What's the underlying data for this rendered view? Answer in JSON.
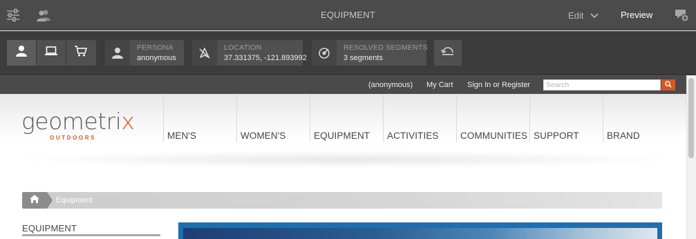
{
  "toolbar": {
    "side_panel_icon": "sliders-icon",
    "emulator_icon": "users-icon",
    "title": "EQUIPMENT",
    "mode_label": "Edit",
    "preview_label": "Preview",
    "annotation_icon": "add-annotation-icon"
  },
  "context_hub": {
    "profile_buttons": [
      {
        "icon": "person-icon"
      },
      {
        "icon": "laptop-icon"
      },
      {
        "icon": "cart-icon"
      }
    ],
    "persona": {
      "label": "PERSONA",
      "value": "anonymous",
      "icon": "person-icon"
    },
    "location": {
      "label": "LOCATION",
      "value": "37.331375, -121.893992",
      "icon": "location-off-icon"
    },
    "segments": {
      "label": "RESOLVED SEGMENTS",
      "value": "3 segments",
      "icon": "target-icon"
    },
    "reset_icon": "reset-icon"
  },
  "site": {
    "util_links": {
      "user": "(anonymous)",
      "cart": "My Cart",
      "signin": "Sign In or Register"
    },
    "search_placeholder": "Search",
    "accent_color": "#d8581f",
    "logo": {
      "main_prefix": "geometri",
      "main_x": "x",
      "sub": "OUTDOORS"
    },
    "nav": [
      "MEN'S",
      "WOMEN'S",
      "EQUIPMENT",
      "ACTIVITIES",
      "COMMUNITIES",
      "SUPPORT",
      "BRAND"
    ],
    "breadcrumb": {
      "home_icon": "home-icon",
      "current": "Equipment"
    },
    "sidebar_title": "EQUIPMENT"
  }
}
